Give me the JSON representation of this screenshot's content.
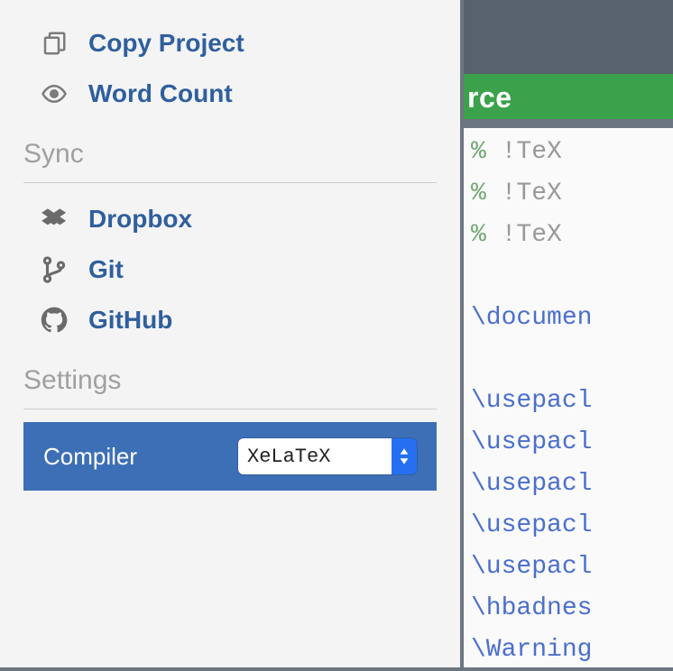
{
  "menu": {
    "copy_project": "Copy Project",
    "word_count": "Word Count"
  },
  "sections": {
    "sync": "Sync",
    "settings": "Settings"
  },
  "sync": {
    "dropbox": "Dropbox",
    "git": "Git",
    "github": "GitHub"
  },
  "settings": {
    "compiler_label": "Compiler",
    "compiler_value": "XeLaTeX"
  },
  "editor": {
    "tab_label": "rce",
    "lines": {
      "l1a": "% ",
      "l1b": "!TeX ",
      "l2a": "% ",
      "l2b": "!TeX ",
      "l3a": "% ",
      "l3b": "!TeX ",
      "l4": "\\documen",
      "l5": "\\usepacl",
      "l6": "\\usepacl",
      "l7": "\\usepacl",
      "l8": "\\usepacl",
      "l9": "\\usepacl",
      "l10": "\\hbadnes",
      "l11": "\\Warning"
    }
  }
}
